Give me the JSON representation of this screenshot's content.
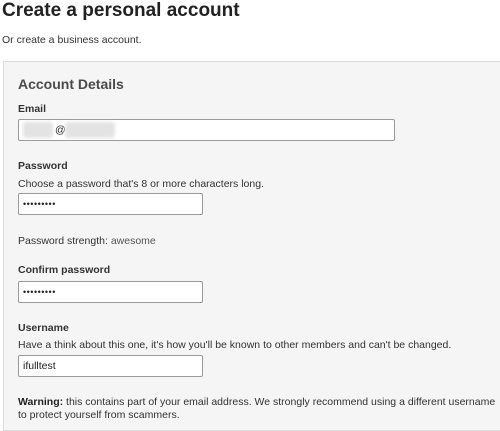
{
  "page": {
    "title": "Create a personal account",
    "subtitle": "Or create a business account."
  },
  "section": {
    "heading": "Account Details"
  },
  "email": {
    "label": "Email",
    "value_visible": "@"
  },
  "password": {
    "label": "Password",
    "help": "Choose a password that's 8 or more characters long.",
    "masked_value": "•••••••••"
  },
  "strength": {
    "label": "Password strength:",
    "value": "awesome"
  },
  "confirm_password": {
    "label": "Confirm password",
    "masked_value": "•••••••••"
  },
  "username": {
    "label": "Username",
    "help": "Have a think about this one, it's how you'll be known to other members and can't be changed.",
    "value": "ifulltest"
  },
  "warning": {
    "prefix": "Warning:",
    "text": " this contains part of your email address. We strongly recommend using a different username to protect yourself from scammers."
  }
}
